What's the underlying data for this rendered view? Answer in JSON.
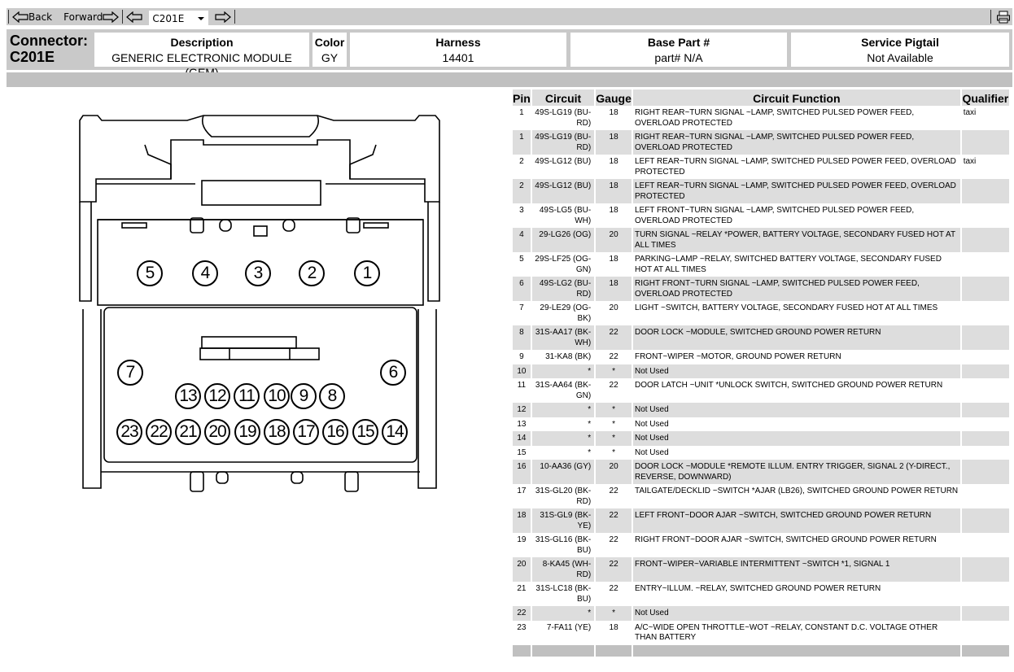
{
  "toolbar": {
    "back_label": "Back",
    "forward_label": "Forward",
    "connector_select_value": "C201E",
    "icons": [
      "back-arrow-icon",
      "forward-arrow-icon",
      "prev-arrow-icon",
      "next-arrow-icon",
      "print-icon"
    ]
  },
  "header": {
    "connector_label": "Connector:",
    "connector_id": "C201E",
    "fields": [
      {
        "label": "Description",
        "value": "GENERIC ELECTRONIC MODULE (GEM)"
      },
      {
        "label": "Color",
        "value": "GY"
      },
      {
        "label": "Harness",
        "value": "14401"
      },
      {
        "label": "Base Part #",
        "value": "part# N/A"
      },
      {
        "label": "Service Pigtail",
        "value": "Not Available"
      }
    ]
  },
  "diagram": {
    "top_row_pins": [
      "5",
      "4",
      "3",
      "2",
      "1"
    ],
    "side_pins": [
      "7",
      "6"
    ],
    "middle_row_pins": [
      "13",
      "12",
      "11",
      "10",
      "9",
      "8"
    ],
    "bottom_row_pins": [
      "23",
      "22",
      "21",
      "20",
      "19",
      "18",
      "17",
      "16",
      "15",
      "14"
    ]
  },
  "table": {
    "headers": [
      "Pin",
      "Circuit",
      "Gauge",
      "Circuit Function",
      "Qualifier"
    ],
    "rows": [
      {
        "pin": "1",
        "circuit": "49S-LG19 (BU-RD)",
        "gauge": "18",
        "function": "RIGHT REAR~TURN SIGNAL ~LAMP, SWITCHED PULSED POWER FEED, OVERLOAD PROTECTED",
        "qualifier": "taxi"
      },
      {
        "pin": "1",
        "circuit": "49S-LG19 (BU-RD)",
        "gauge": "18",
        "function": "RIGHT REAR~TURN SIGNAL ~LAMP, SWITCHED PULSED POWER FEED, OVERLOAD PROTECTED",
        "qualifier": ""
      },
      {
        "pin": "2",
        "circuit": "49S-LG12 (BU)",
        "gauge": "18",
        "function": "LEFT REAR~TURN SIGNAL ~LAMP, SWITCHED PULSED POWER FEED, OVERLOAD PROTECTED",
        "qualifier": "taxi"
      },
      {
        "pin": "2",
        "circuit": "49S-LG12 (BU)",
        "gauge": "18",
        "function": "LEFT REAR~TURN SIGNAL ~LAMP, SWITCHED PULSED POWER FEED, OVERLOAD PROTECTED",
        "qualifier": ""
      },
      {
        "pin": "3",
        "circuit": "49S-LG5 (BU-WH)",
        "gauge": "18",
        "function": "LEFT FRONT~TURN SIGNAL ~LAMP, SWITCHED PULSED POWER FEED, OVERLOAD PROTECTED",
        "qualifier": ""
      },
      {
        "pin": "4",
        "circuit": "29-LG26 (OG)",
        "gauge": "20",
        "function": "TURN SIGNAL ~RELAY *POWER, BATTERY VOLTAGE, SECONDARY FUSED HOT AT ALL TIMES",
        "qualifier": ""
      },
      {
        "pin": "5",
        "circuit": "29S-LF25 (OG-GN)",
        "gauge": "18",
        "function": "PARKING~LAMP ~RELAY, SWITCHED BATTERY VOLTAGE, SECONDARY FUSED HOT AT ALL TIMES",
        "qualifier": ""
      },
      {
        "pin": "6",
        "circuit": "49S-LG2 (BU-RD)",
        "gauge": "18",
        "function": "RIGHT FRONT~TURN SIGNAL ~LAMP, SWITCHED PULSED POWER FEED, OVERLOAD PROTECTED",
        "qualifier": ""
      },
      {
        "pin": "7",
        "circuit": "29-LE29 (OG-BK)",
        "gauge": "20",
        "function": "LIGHT ~SWITCH, BATTERY VOLTAGE, SECONDARY FUSED HOT AT ALL TIMES",
        "qualifier": ""
      },
      {
        "pin": "8",
        "circuit": "31S-AA17 (BK-WH)",
        "gauge": "22",
        "function": "DOOR LOCK ~MODULE, SWITCHED GROUND POWER RETURN",
        "qualifier": ""
      },
      {
        "pin": "9",
        "circuit": "31-KA8 (BK)",
        "gauge": "22",
        "function": "FRONT~WIPER ~MOTOR, GROUND POWER RETURN",
        "qualifier": ""
      },
      {
        "pin": "10",
        "circuit": "*",
        "gauge": "*",
        "function": "Not Used",
        "qualifier": ""
      },
      {
        "pin": "11",
        "circuit": "31S-AA64 (BK-GN)",
        "gauge": "22",
        "function": "DOOR LATCH ~UNIT *UNLOCK SWITCH, SWITCHED GROUND POWER RETURN",
        "qualifier": ""
      },
      {
        "pin": "12",
        "circuit": "*",
        "gauge": "*",
        "function": "Not Used",
        "qualifier": ""
      },
      {
        "pin": "13",
        "circuit": "*",
        "gauge": "*",
        "function": "Not Used",
        "qualifier": ""
      },
      {
        "pin": "14",
        "circuit": "*",
        "gauge": "*",
        "function": "Not Used",
        "qualifier": ""
      },
      {
        "pin": "15",
        "circuit": "*",
        "gauge": "*",
        "function": "Not Used",
        "qualifier": ""
      },
      {
        "pin": "16",
        "circuit": "10-AA36 (GY)",
        "gauge": "20",
        "function": "DOOR LOCK ~MODULE *REMOTE ILLUM. ENTRY TRIGGER, SIGNAL 2 (Y-DIRECT., REVERSE, DOWNWARD)",
        "qualifier": ""
      },
      {
        "pin": "17",
        "circuit": "31S-GL20 (BK-RD)",
        "gauge": "22",
        "function": "TAILGATE/DECKLID ~SWITCH *AJAR (LB26), SWITCHED GROUND POWER RETURN",
        "qualifier": ""
      },
      {
        "pin": "18",
        "circuit": "31S-GL9 (BK-YE)",
        "gauge": "22",
        "function": "LEFT FRONT~DOOR AJAR ~SWITCH, SWITCHED GROUND POWER RETURN",
        "qualifier": ""
      },
      {
        "pin": "19",
        "circuit": "31S-GL16 (BK-BU)",
        "gauge": "22",
        "function": "RIGHT FRONT~DOOR AJAR ~SWITCH, SWITCHED GROUND POWER RETURN",
        "qualifier": ""
      },
      {
        "pin": "20",
        "circuit": "8-KA45 (WH-RD)",
        "gauge": "22",
        "function": "FRONT~WIPER~VARIABLE INTERMITTENT ~SWITCH *1, SIGNAL 1",
        "qualifier": ""
      },
      {
        "pin": "21",
        "circuit": "31S-LC18 (BK-BU)",
        "gauge": "22",
        "function": "ENTRY~ILLUM. ~RELAY, SWITCHED GROUND POWER RETURN",
        "qualifier": ""
      },
      {
        "pin": "22",
        "circuit": "*",
        "gauge": "*",
        "function": "Not Used",
        "qualifier": ""
      },
      {
        "pin": "23",
        "circuit": "7-FA11 (YE)",
        "gauge": "18",
        "function": "A/C~WIDE OPEN THROTTLE~WOT ~RELAY, CONSTANT D.C. VOLTAGE OTHER THAN BATTERY",
        "qualifier": ""
      }
    ]
  }
}
